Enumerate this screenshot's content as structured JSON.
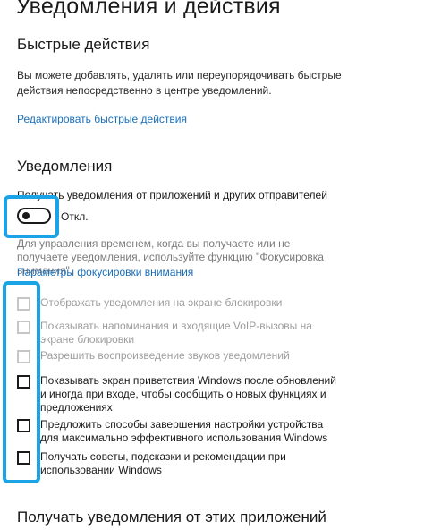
{
  "page": {
    "title": "Уведомления и действия"
  },
  "quick_actions": {
    "title": "Быстрые действия",
    "description": "Вы можете добавлять, удалять или переупорядочивать быстрые действия непосредственно в центре уведомлений.",
    "edit_link": "Редактировать быстрые действия"
  },
  "notifications": {
    "title": "Уведомления",
    "toggle_label": "Получать уведомления от приложений и других отправителей",
    "toggle_state": "Откл.",
    "toggle_on": false,
    "focus_description": "Для управления временем, когда вы получаете или не получаете уведомления, используйте функцию \"Фокусировка внимания\".",
    "focus_link": "Параметры фокусировки внимания",
    "options": [
      {
        "label": "Отображать уведомления на экране блокировки",
        "checked": false,
        "disabled": true
      },
      {
        "label": "Показывать напоминания и входящие VoIP-вызовы на экране блокировки",
        "checked": false,
        "disabled": true
      },
      {
        "label": "Разрешить воспроизведение звуков уведомлений",
        "checked": false,
        "disabled": true
      },
      {
        "label": "Показывать экран приветствия Windows после обновлений и иногда при входе, чтобы сообщить о новых функциях и предложениях",
        "checked": false,
        "disabled": false
      },
      {
        "label": "Предложить способы завершения настройки устройства для максимально эффективного использования Windows",
        "checked": false,
        "disabled": false
      },
      {
        "label": "Получать советы, подсказки и рекомендации при использовании Windows",
        "checked": false,
        "disabled": false
      }
    ]
  },
  "apps_section": {
    "title": "Получать уведомления от этих приложений"
  },
  "colors": {
    "link": "#1b6fb8",
    "highlight": "#1aa3e6",
    "disabled_text": "#9d9d9d"
  }
}
